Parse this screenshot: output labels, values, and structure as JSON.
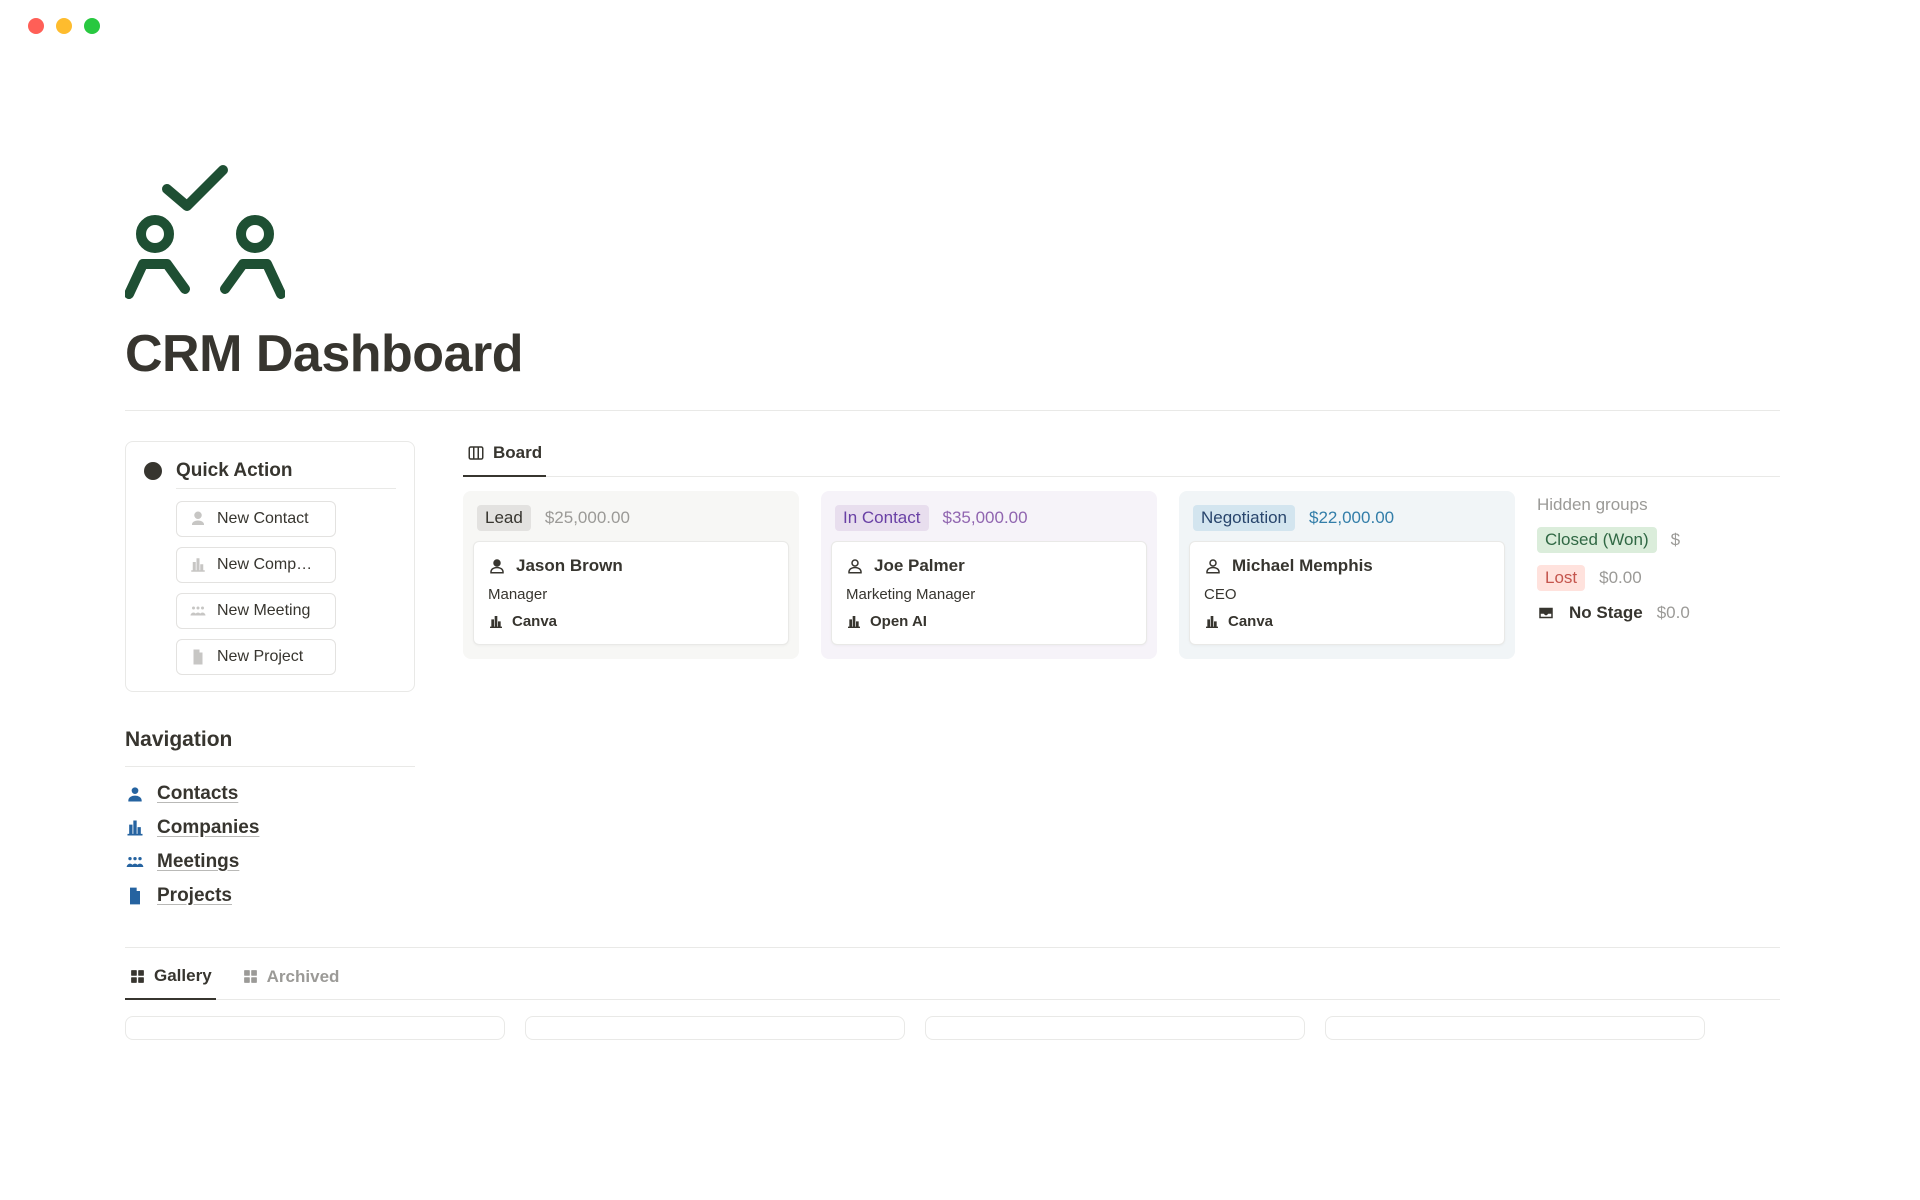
{
  "page_title": "CRM Dashboard",
  "quick_action": {
    "title": "Quick Action",
    "items": [
      {
        "label": "New Contact"
      },
      {
        "label": "New Comp…"
      },
      {
        "label": "New Meeting"
      },
      {
        "label": "New Project"
      }
    ]
  },
  "navigation": {
    "title": "Navigation",
    "items": [
      {
        "label": "Contacts"
      },
      {
        "label": "Companies"
      },
      {
        "label": "Meetings"
      },
      {
        "label": "Projects"
      }
    ]
  },
  "board_tab": "Board",
  "columns": [
    {
      "stage": "Lead",
      "amount": "$25,000.00",
      "card": {
        "name": "Jason Brown",
        "role": "Manager",
        "company": "Canva"
      }
    },
    {
      "stage": "In Contact",
      "amount": "$35,000.00",
      "card": {
        "name": "Joe Palmer",
        "role": "Marketing Manager",
        "company": "Open AI"
      }
    },
    {
      "stage": "Negotiation",
      "amount": "$22,000.00",
      "card": {
        "name": "Michael Memphis",
        "role": "CEO",
        "company": "Canva"
      }
    }
  ],
  "hidden": {
    "title": "Hidden groups",
    "won": {
      "label": "Closed (Won)",
      "amount": "$"
    },
    "lost": {
      "label": "Lost",
      "amount": "$0.00"
    },
    "nostage": {
      "label": "No Stage",
      "amount": "$0.0"
    }
  },
  "bottom_tabs": {
    "gallery": "Gallery",
    "archived": "Archived"
  }
}
